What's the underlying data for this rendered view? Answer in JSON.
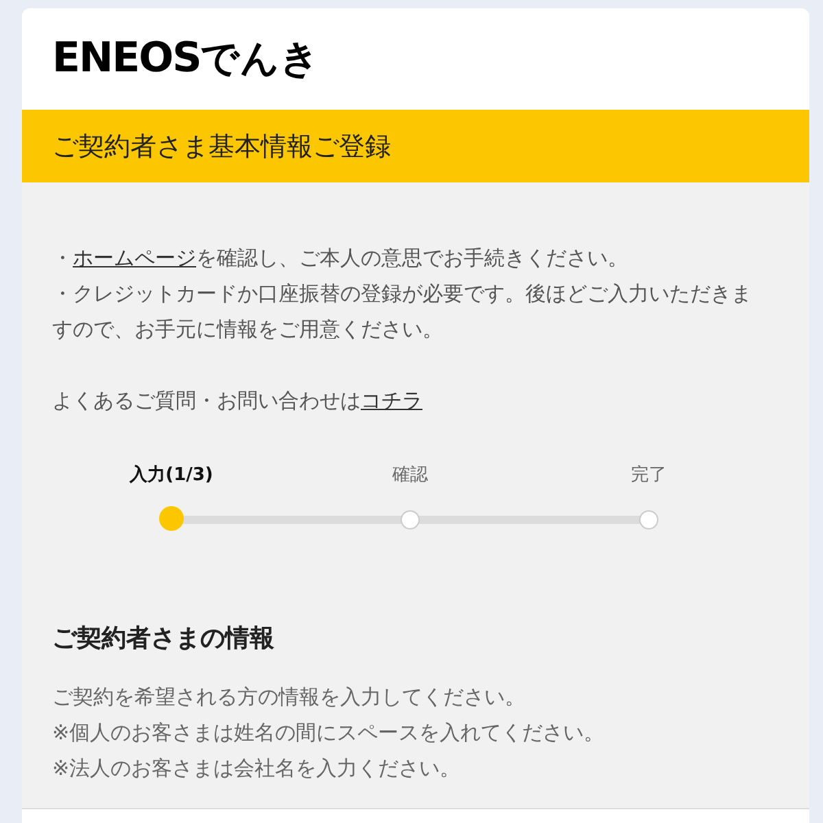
{
  "logo": {
    "latin": "ENEOS",
    "kana": "でんき"
  },
  "banner": {
    "title": "ご契約者さま基本情報ご登録"
  },
  "notes": [
    {
      "before": "・",
      "link": "ホームページ",
      "after": "を確認し、ご本人の意思でお手続きください。"
    },
    {
      "before": "・クレジットカードか口座振替の登録が必要です。後ほどご入力いただきますので、お手元に情報をご用意ください。"
    }
  ],
  "faq": {
    "before": "よくあるご質問・お問い合わせは",
    "link": "コチラ"
  },
  "steps": [
    {
      "label": "入力(1/3)",
      "selected": true
    },
    {
      "label": "確認",
      "selected": false
    },
    {
      "label": "完了",
      "selected": false
    }
  ],
  "section": {
    "title": "ご契約者さまの情報",
    "lines": [
      "ご契約を希望される方の情報を入力してください。",
      "※個人のお客さまは姓名の間にスペースを入れてください。",
      "※法人のお客さまは会社名を入力ください。"
    ]
  }
}
